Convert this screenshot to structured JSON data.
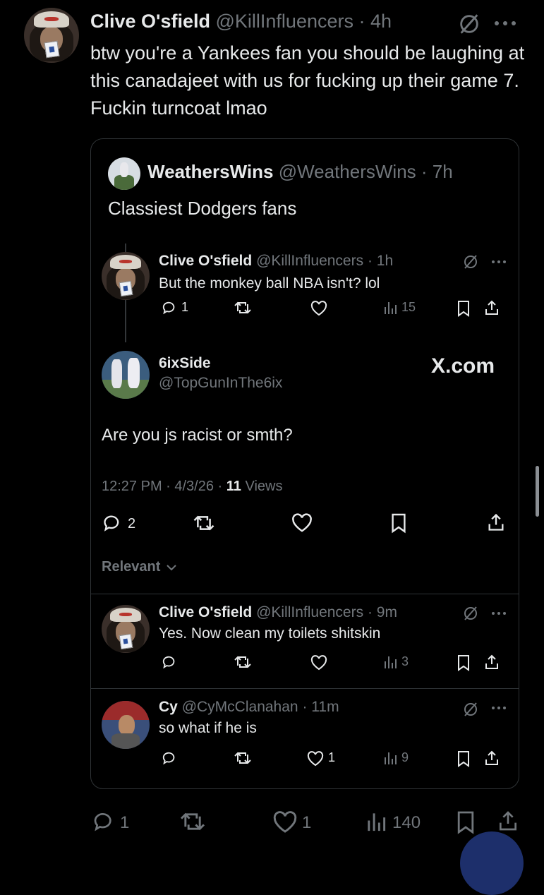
{
  "main_tweet": {
    "display_name": "Clive O'sfield",
    "handle": "@KillInfluencers",
    "time": "· 4h",
    "text": "btw you're a Yankees fan you should be laughing at this canadajeet with us for fucking up their game 7. Fuckin turncoat lmao",
    "stats": {
      "replies": "1",
      "likes": "1",
      "views": "140"
    }
  },
  "quote": {
    "display_name": "WeathersWins",
    "handle": "@WeathersWins",
    "time": "· 7h",
    "text": "Classiest Dodgers fans",
    "screenshot": {
      "parent_reply": {
        "display_name": "Clive O'sfield",
        "handle": "@KillInfluencers",
        "time": "· 1h",
        "text": "But the monkey ball NBA isn't? lol",
        "stats": {
          "replies": "1",
          "views": "15"
        }
      },
      "focus_reply": {
        "display_name": "6ixSide",
        "handle": "@TopGunInThe6ix",
        "text": "Are you js racist or smth?",
        "meta_time": "12:27 PM · 4/3/26 · ",
        "views_count": "11",
        "views_label": " Views",
        "stats": {
          "replies": "2"
        }
      },
      "watermark": "X.com",
      "sort_label": "Relevant",
      "replies": [
        {
          "display_name": "Clive O'sfield",
          "handle": "@KillInfluencers",
          "time": "· 9m",
          "text": "Yes. Now clean my toilets shitskin",
          "stats": {
            "views": "3"
          }
        },
        {
          "display_name": "Cy",
          "handle": "@CyMcClanahan",
          "time": "· 11m",
          "text": "so what if he is",
          "stats": {
            "likes": "1",
            "views": "9"
          }
        }
      ]
    }
  },
  "colors": {
    "background": "#000000",
    "text": "#e7e9ea",
    "muted": "#71767b",
    "border": "#2f3336"
  },
  "icons": [
    "grok-icon",
    "more-icon",
    "reply-icon",
    "retweet-icon",
    "like-icon",
    "views-icon",
    "bookmark-icon",
    "share-icon",
    "chevron-down-icon"
  ]
}
